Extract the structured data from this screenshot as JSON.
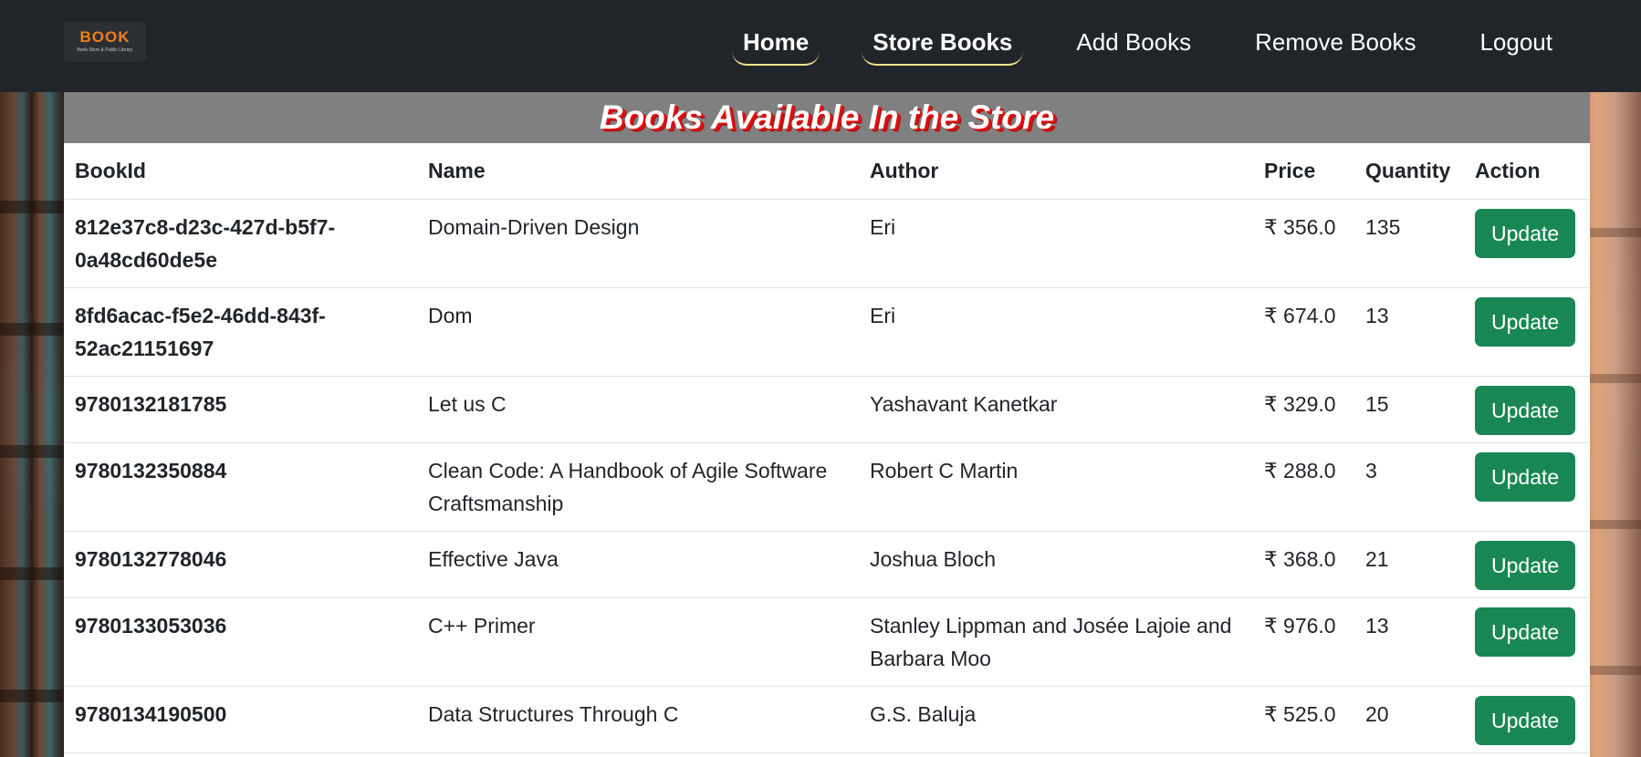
{
  "navbar": {
    "logo": {
      "text": "BOOK",
      "subtitle": "Book Store & Public Library"
    },
    "links": [
      {
        "label": "Home",
        "active": true
      },
      {
        "label": "Store Books",
        "active": true
      },
      {
        "label": "Add Books",
        "active": false
      },
      {
        "label": "Remove Books",
        "active": false
      },
      {
        "label": "Logout",
        "active": false
      }
    ]
  },
  "panel": {
    "title": "Books Available In the Store",
    "columns": [
      "BookId",
      "Name",
      "Author",
      "Price",
      "Quantity",
      "Action"
    ],
    "rows": [
      {
        "bookid": "812e37c8-d23c-427d-b5f7-0a48cd60de5e",
        "name": "Domain-Driven Design",
        "author": "Eri",
        "price": "₹ 356.0",
        "quantity": "135",
        "action": "Update"
      },
      {
        "bookid": "8fd6acac-f5e2-46dd-843f-52ac21151697",
        "name": "Dom",
        "author": "Eri",
        "price": "₹ 674.0",
        "quantity": "13",
        "action": "Update"
      },
      {
        "bookid": "9780132181785",
        "name": "Let us C",
        "author": "Yashavant Kanetkar",
        "price": "₹ 329.0",
        "quantity": "15",
        "action": "Update"
      },
      {
        "bookid": "9780132350884",
        "name": "Clean Code: A Handbook of Agile Software Craftsmanship",
        "author": "Robert C Martin",
        "price": "₹ 288.0",
        "quantity": "3",
        "action": "Update"
      },
      {
        "bookid": "9780132778046",
        "name": "Effective Java",
        "author": "Joshua Bloch",
        "price": "₹ 368.0",
        "quantity": "21",
        "action": "Update"
      },
      {
        "bookid": "9780133053036",
        "name": "C++ Primer",
        "author": "Stanley Lippman and Josée Lajoie and Barbara Moo",
        "price": "₹ 976.0",
        "quantity": "13",
        "action": "Update"
      },
      {
        "bookid": "9780134190500",
        "name": "Data Structures Through C",
        "author": "G.S. Baluja",
        "price": "₹ 525.0",
        "quantity": "20",
        "action": "Update"
      }
    ]
  },
  "colors": {
    "navbar_bg": "#212529",
    "title_bar_bg": "#808080",
    "title_shadow": "#e01010",
    "button_bg": "#198754",
    "logo_accent": "#f07f1a",
    "active_underline": "#f4e58a"
  }
}
